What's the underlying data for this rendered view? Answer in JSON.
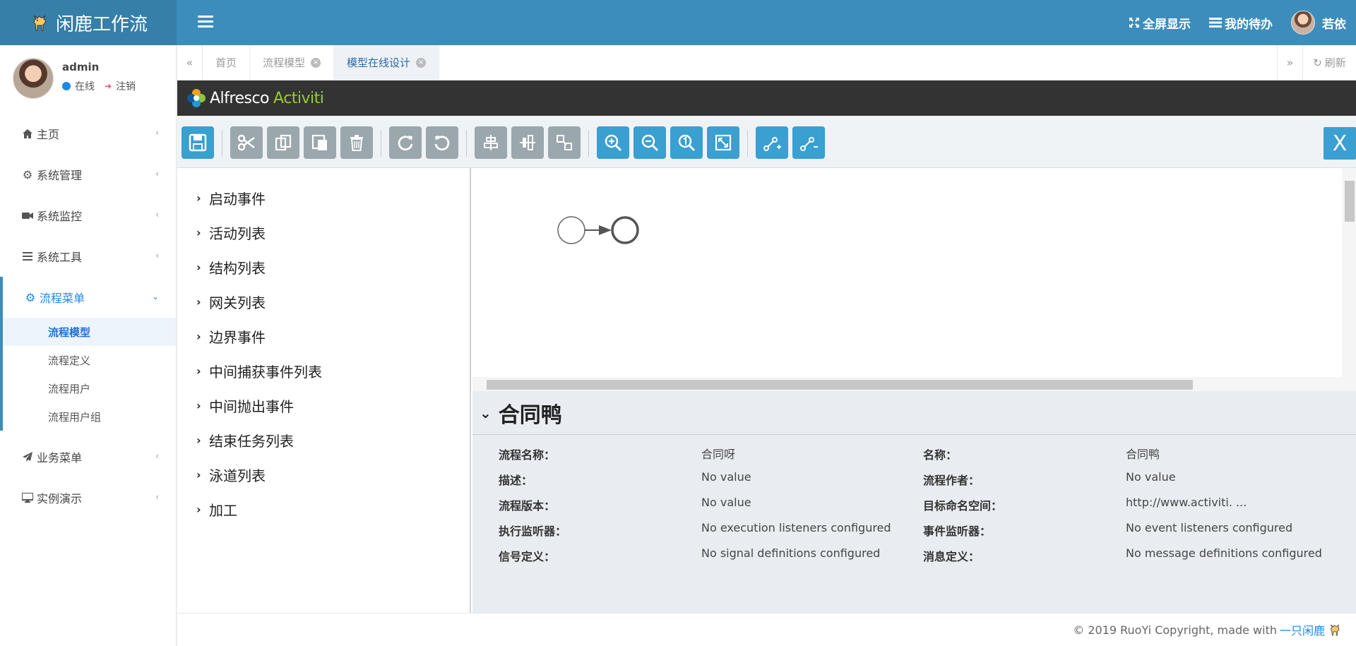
{
  "app": {
    "title": "闲鹿工作流"
  },
  "topbar": {
    "fullscreen_label": "全屏显示",
    "todo_label": "我的待办",
    "user_name": "若依"
  },
  "user_panel": {
    "name": "admin",
    "status": "在线",
    "logout": "注销"
  },
  "sidebar": {
    "items": [
      {
        "label": "主页",
        "icon": "home-icon"
      },
      {
        "label": "系统管理",
        "icon": "gear-icon"
      },
      {
        "label": "系统监控",
        "icon": "video-camera-icon"
      },
      {
        "label": "系统工具",
        "icon": "bars-icon"
      },
      {
        "label": "流程菜单",
        "icon": "cogs-icon",
        "expanded": true
      },
      {
        "label": "业务菜单",
        "icon": "paper-plane-icon"
      },
      {
        "label": "实例演示",
        "icon": "desktop-icon"
      }
    ],
    "flow_submenu": [
      {
        "label": "流程模型",
        "current": true
      },
      {
        "label": "流程定义"
      },
      {
        "label": "流程用户"
      },
      {
        "label": "流程用户组"
      }
    ]
  },
  "tabs": {
    "items": [
      {
        "label": "首页"
      },
      {
        "label": "流程模型",
        "closable": true
      },
      {
        "label": "模型在线设计",
        "closable": true,
        "active": true
      }
    ],
    "refresh_label": "刷新"
  },
  "editor": {
    "brand_part1": "Alfresco",
    "brand_part2": "Activiti",
    "close_label": "X",
    "toolbar": [
      "save-icon",
      "cut-icon",
      "copy-icon",
      "paste-icon",
      "delete-icon",
      "redo-icon",
      "undo-icon",
      "align-horizontal-icon",
      "align-vertical-icon",
      "same-size-icon",
      "zoom-in-icon",
      "zoom-out-icon",
      "zoom-actual-icon",
      "zoom-fit-icon",
      "add-bendpoint-icon",
      "remove-bendpoint-icon"
    ],
    "palette": [
      "启动事件",
      "活动列表",
      "结构列表",
      "网关列表",
      "边界事件",
      "中间捕获事件列表",
      "中间抛出事件",
      "结束任务列表",
      "泳道列表",
      "加工"
    ],
    "properties": {
      "title": "合同鸭",
      "rows": [
        {
          "label": "流程名称：",
          "value": "合同呀",
          "label2": "名称：",
          "value2": "合同鸭"
        },
        {
          "label": "描述：",
          "value": "No value",
          "label2": "流程作者：",
          "value2": "No value"
        },
        {
          "label": "流程版本：",
          "value": "No value",
          "label2": "目标命名空间：",
          "value2": "http://www.activiti. ..."
        },
        {
          "label": "执行监听器：",
          "value": "No execution listeners configured",
          "label2": "事件监听器：",
          "value2": "No event listeners configured"
        },
        {
          "label": "信号定义：",
          "value": "No signal definitions configured",
          "label2": "消息定义：",
          "value2": "No message definitions configured"
        }
      ]
    }
  },
  "footer": {
    "text": "© 2019 RuoYi Copyright, made with",
    "link": "一只闲鹿"
  }
}
